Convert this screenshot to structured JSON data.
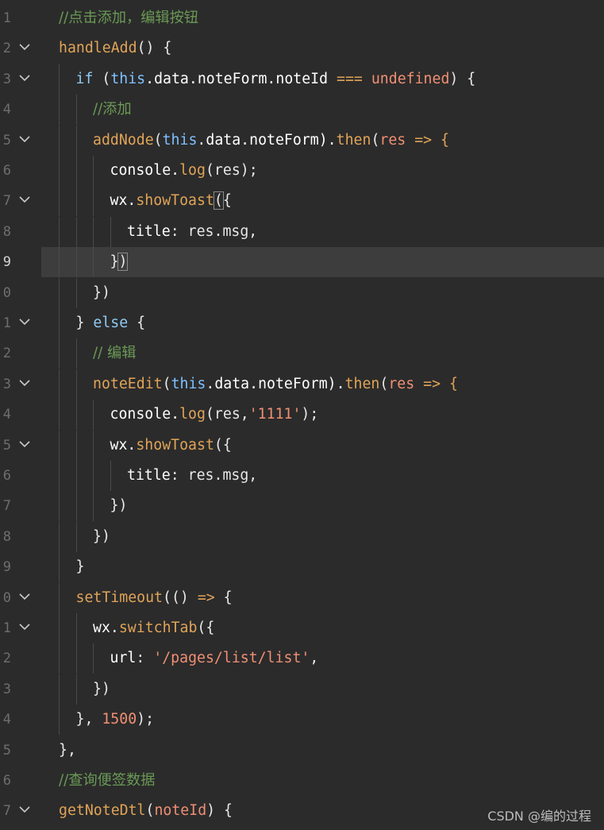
{
  "editor": {
    "line_numbers": [
      "1",
      "2",
      "3",
      "4",
      "5",
      "6",
      "7",
      "8",
      "9",
      "0",
      "1",
      "2",
      "3",
      "4",
      "5",
      "6",
      "7",
      "8",
      "9",
      "0",
      "1",
      "2",
      "3",
      "4",
      "5",
      "6",
      "7"
    ],
    "current_line_index": 8,
    "folded_line_indices": [
      1,
      2,
      4,
      6,
      10,
      12,
      14,
      19,
      20,
      26
    ],
    "lines": [
      {
        "indent": 0,
        "tokens": [
          {
            "t": "//点击添加，编辑按钮",
            "c": "comment cn"
          }
        ]
      },
      {
        "indent": 0,
        "tokens": [
          {
            "t": "handleAdd",
            "c": "fn"
          },
          {
            "t": "() {",
            "c": "punc"
          }
        ]
      },
      {
        "indent": 1,
        "tokens": [
          {
            "t": "if",
            "c": "kw"
          },
          {
            "t": " (",
            "c": "punc"
          },
          {
            "t": "this",
            "c": "kwc"
          },
          {
            "t": ".data.noteForm.noteId ",
            "c": "prop"
          },
          {
            "t": "===",
            "c": "fn"
          },
          {
            "t": " ",
            "c": "punc"
          },
          {
            "t": "undefined",
            "c": "str"
          },
          {
            "t": ") {",
            "c": "punc"
          }
        ]
      },
      {
        "indent": 2,
        "tokens": [
          {
            "t": "//添加",
            "c": "comment cn"
          }
        ]
      },
      {
        "indent": 2,
        "tokens": [
          {
            "t": "addNode",
            "c": "fn"
          },
          {
            "t": "(",
            "c": "punc"
          },
          {
            "t": "this",
            "c": "kwc"
          },
          {
            "t": ".data.noteForm).",
            "c": "prop"
          },
          {
            "t": "then",
            "c": "fn"
          },
          {
            "t": "(",
            "c": "punc"
          },
          {
            "t": "res",
            "c": "param"
          },
          {
            "t": " => {",
            "c": "fn"
          }
        ]
      },
      {
        "indent": 3,
        "tokens": [
          {
            "t": "console.",
            "c": "prop"
          },
          {
            "t": "log",
            "c": "fn"
          },
          {
            "t": "(res);",
            "c": "punc"
          }
        ]
      },
      {
        "indent": 3,
        "tokens": [
          {
            "t": "wx.",
            "c": "prop"
          },
          {
            "t": "showToast",
            "c": "fn"
          },
          {
            "t": "(",
            "c": "punc cursor-box"
          },
          {
            "t": "{",
            "c": "brace"
          }
        ]
      },
      {
        "indent": 4,
        "tokens": [
          {
            "t": "title",
            "c": "prop"
          },
          {
            "t": ": res.msg,",
            "c": "punc"
          }
        ]
      },
      {
        "indent": 3,
        "tokens": [
          {
            "t": "}",
            "c": "brace"
          },
          {
            "t": ")",
            "c": "punc cursor-box"
          }
        ]
      },
      {
        "indent": 2,
        "tokens": [
          {
            "t": "})",
            "c": "punc"
          }
        ]
      },
      {
        "indent": 1,
        "tokens": [
          {
            "t": "} ",
            "c": "punc"
          },
          {
            "t": "else",
            "c": "kw"
          },
          {
            "t": " {",
            "c": "punc"
          }
        ]
      },
      {
        "indent": 2,
        "tokens": [
          {
            "t": "// 编辑",
            "c": "comment cn"
          }
        ]
      },
      {
        "indent": 2,
        "tokens": [
          {
            "t": "noteEdit",
            "c": "fn"
          },
          {
            "t": "(",
            "c": "punc"
          },
          {
            "t": "this",
            "c": "kwc"
          },
          {
            "t": ".data.noteForm).",
            "c": "prop"
          },
          {
            "t": "then",
            "c": "fn"
          },
          {
            "t": "(",
            "c": "punc"
          },
          {
            "t": "res",
            "c": "param"
          },
          {
            "t": " => {",
            "c": "fn"
          }
        ]
      },
      {
        "indent": 3,
        "tokens": [
          {
            "t": "console.",
            "c": "prop"
          },
          {
            "t": "log",
            "c": "fn"
          },
          {
            "t": "(res,",
            "c": "punc"
          },
          {
            "t": "'1111'",
            "c": "str"
          },
          {
            "t": ");",
            "c": "punc"
          }
        ]
      },
      {
        "indent": 3,
        "tokens": [
          {
            "t": "wx.",
            "c": "prop"
          },
          {
            "t": "showToast",
            "c": "fn"
          },
          {
            "t": "({",
            "c": "punc"
          }
        ]
      },
      {
        "indent": 4,
        "tokens": [
          {
            "t": "title",
            "c": "prop"
          },
          {
            "t": ": res.msg,",
            "c": "punc"
          }
        ]
      },
      {
        "indent": 3,
        "tokens": [
          {
            "t": "})",
            "c": "punc"
          }
        ]
      },
      {
        "indent": 2,
        "tokens": [
          {
            "t": "})",
            "c": "punc"
          }
        ]
      },
      {
        "indent": 1,
        "tokens": [
          {
            "t": "}",
            "c": "punc"
          }
        ]
      },
      {
        "indent": 1,
        "tokens": [
          {
            "t": "setTimeout",
            "c": "fn"
          },
          {
            "t": "(() ",
            "c": "punc"
          },
          {
            "t": "=>",
            "c": "fn"
          },
          {
            "t": " {",
            "c": "punc"
          }
        ]
      },
      {
        "indent": 2,
        "tokens": [
          {
            "t": "wx.",
            "c": "prop"
          },
          {
            "t": "switchTab",
            "c": "fn"
          },
          {
            "t": "({",
            "c": "punc"
          }
        ]
      },
      {
        "indent": 3,
        "tokens": [
          {
            "t": "url",
            "c": "prop"
          },
          {
            "t": ": ",
            "c": "punc"
          },
          {
            "t": "'/pages/list/list'",
            "c": "str"
          },
          {
            "t": ",",
            "c": "punc"
          }
        ]
      },
      {
        "indent": 2,
        "tokens": [
          {
            "t": "})",
            "c": "punc"
          }
        ]
      },
      {
        "indent": 1,
        "tokens": [
          {
            "t": "}, ",
            "c": "punc"
          },
          {
            "t": "1500",
            "c": "num"
          },
          {
            "t": ");",
            "c": "punc"
          }
        ]
      },
      {
        "indent": 0,
        "tokens": [
          {
            "t": "},",
            "c": "punc"
          }
        ]
      },
      {
        "indent": 0,
        "tokens": [
          {
            "t": "//查询便签数据",
            "c": "comment cn"
          }
        ]
      },
      {
        "indent": 0,
        "tokens": [
          {
            "t": "getNoteDtl",
            "c": "fn"
          },
          {
            "t": "(",
            "c": "punc"
          },
          {
            "t": "noteId",
            "c": "param"
          },
          {
            "t": ") {",
            "c": "punc"
          }
        ]
      }
    ]
  },
  "watermark": "CSDN @编的过程"
}
